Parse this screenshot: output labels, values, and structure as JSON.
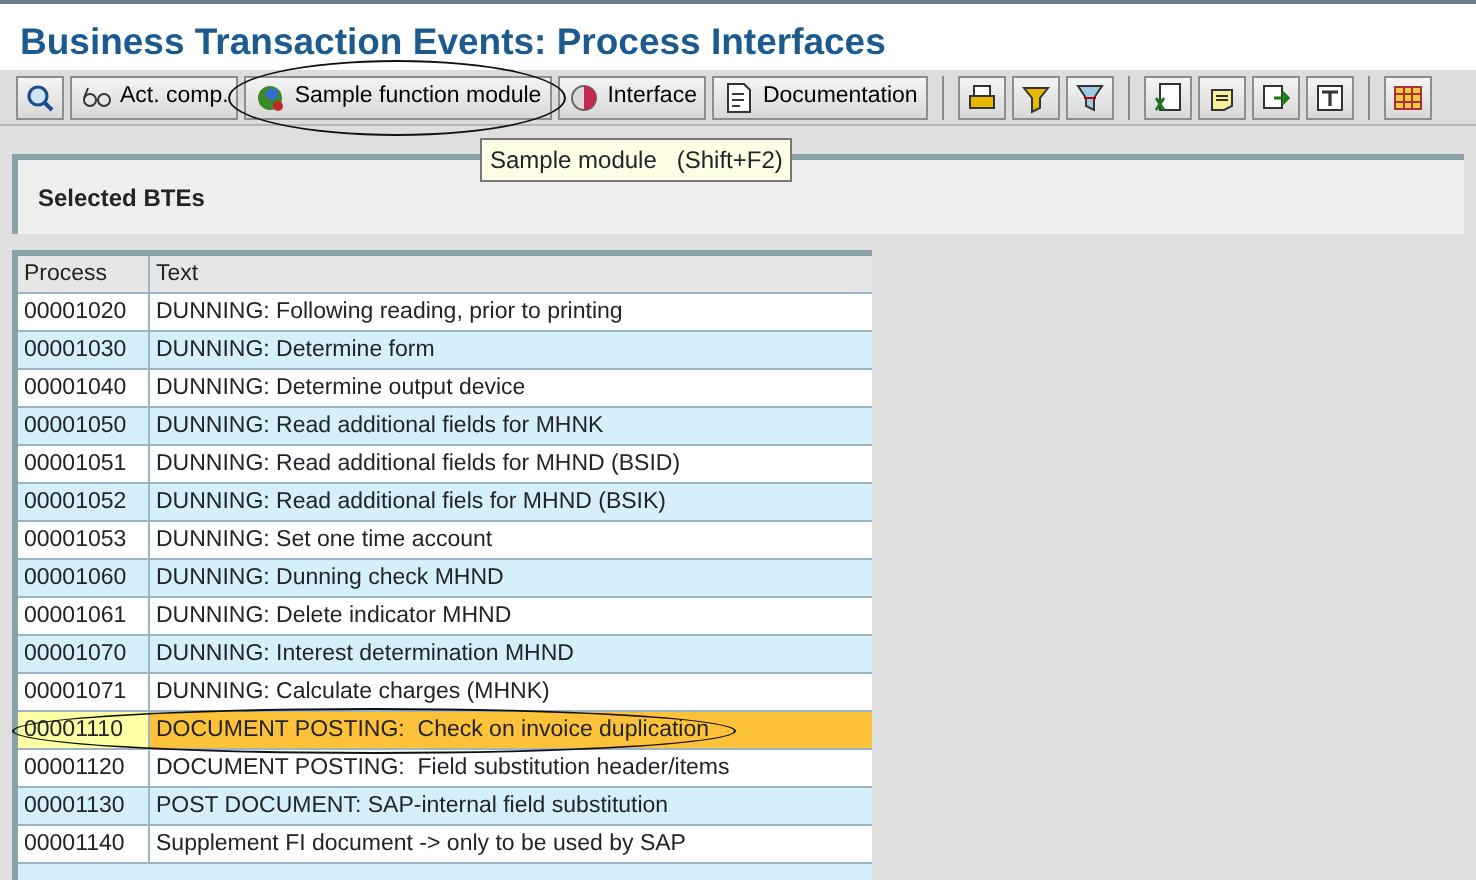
{
  "window": {
    "title": "Business Transaction Events: Process Interfaces"
  },
  "toolbar": [
    {
      "kind": "icon"
    },
    {
      "kind": "button",
      "label": "Act. comp.",
      "circled": false
    },
    {
      "kind": "button",
      "label": "Sample function module",
      "circled": true
    },
    {
      "kind": "button",
      "label": "Interface",
      "circled": false
    },
    {
      "kind": "button",
      "label": "Documentation",
      "circled": false
    },
    {
      "kind": "separator"
    },
    {
      "kind": "icon"
    },
    {
      "kind": "icon"
    },
    {
      "kind": "icon"
    },
    {
      "kind": "separator"
    },
    {
      "kind": "icon"
    },
    {
      "kind": "icon"
    },
    {
      "kind": "icon"
    },
    {
      "kind": "icon"
    },
    {
      "kind": "separator"
    },
    {
      "kind": "icon"
    }
  ],
  "tooltip": {
    "text": "Sample module",
    "shortcut": "(Shift+F2)"
  },
  "panel": {
    "title": "Selected BTEs"
  },
  "table": {
    "columns": [
      "Process",
      "Text"
    ],
    "rows": [
      {
        "process": "00001020",
        "text": "DUNNING: Following reading, prior to printing",
        "selected": false,
        "circled": false
      },
      {
        "process": "00001030",
        "text": "DUNNING: Determine form",
        "selected": false,
        "circled": false
      },
      {
        "process": "00001040",
        "text": "DUNNING: Determine output device",
        "selected": false,
        "circled": false
      },
      {
        "process": "00001050",
        "text": "DUNNING: Read additional fields for MHNK",
        "selected": false,
        "circled": false
      },
      {
        "process": "00001051",
        "text": "DUNNING: Read additional fields for MHND (BSID)",
        "selected": false,
        "circled": false
      },
      {
        "process": "00001052",
        "text": "DUNNING: Read additional fiels for MHND (BSIK)",
        "selected": false,
        "circled": false
      },
      {
        "process": "00001053",
        "text": "DUNNING: Set one time account",
        "selected": false,
        "circled": false
      },
      {
        "process": "00001060",
        "text": "DUNNING: Dunning check MHND",
        "selected": false,
        "circled": false
      },
      {
        "process": "00001061",
        "text": "DUNNING: Delete indicator MHND",
        "selected": false,
        "circled": false
      },
      {
        "process": "00001070",
        "text": "DUNNING: Interest determination MHND",
        "selected": false,
        "circled": false
      },
      {
        "process": "00001071",
        "text": "DUNNING: Calculate charges (MHNK)",
        "selected": false,
        "circled": false
      },
      {
        "process": "00001110",
        "text": "DOCUMENT POSTING:  Check on invoice duplication",
        "selected": true,
        "circled": true
      },
      {
        "process": "00001120",
        "text": "DOCUMENT POSTING:  Field substitution header/items",
        "selected": false,
        "circled": false
      },
      {
        "process": "00001130",
        "text": "POST DOCUMENT: SAP-internal field substitution",
        "selected": false,
        "circled": false
      },
      {
        "process": "00001140",
        "text": "Supplement FI document -> only to be used by SAP",
        "selected": false,
        "circled": false
      }
    ]
  }
}
